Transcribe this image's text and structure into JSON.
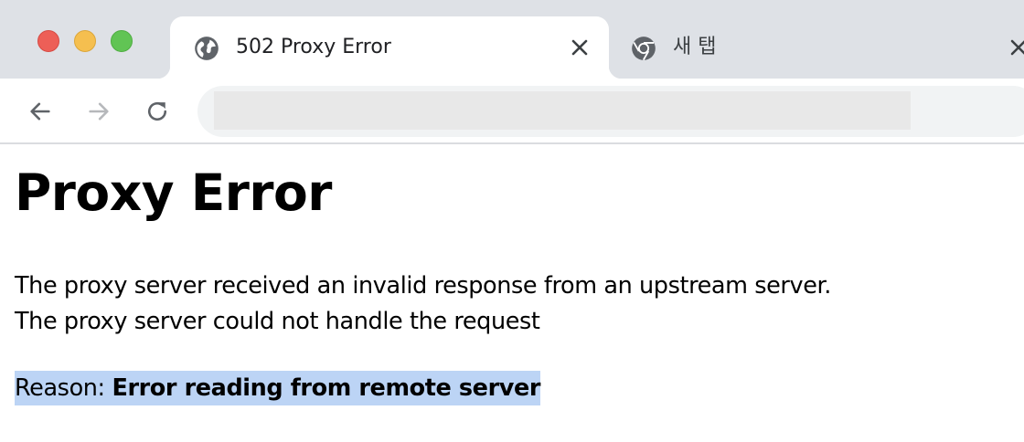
{
  "window": {
    "traffic_lights": {
      "close_color": "#ed5f57",
      "minimize_color": "#f5bf4f",
      "zoom_color": "#61c454"
    }
  },
  "tabs": [
    {
      "title": "502 Proxy Error",
      "icon": "globe-icon",
      "active": true
    },
    {
      "title": "새 탭",
      "icon": "chrome-icon",
      "active": false
    }
  ],
  "toolbar": {
    "back_icon": "arrow-left-icon",
    "forward_icon": "arrow-right-icon",
    "reload_icon": "reload-icon",
    "url_value": ""
  },
  "page": {
    "heading": "Proxy Error",
    "lines": [
      "The proxy server received an invalid response from an upstream server.",
      "The proxy server could not handle the request"
    ],
    "reason_label": "Reason: ",
    "reason_value": "Error reading from remote server",
    "selection_color": "#bcd4f5"
  }
}
